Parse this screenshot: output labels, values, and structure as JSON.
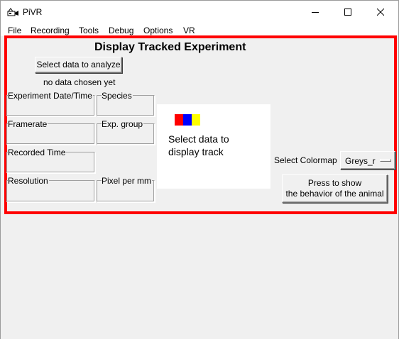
{
  "window": {
    "title": "PiVR",
    "minimize_glyph": "—",
    "maximize_glyph": "☐",
    "close_glyph": "✕"
  },
  "menu": {
    "items": [
      "File",
      "Recording",
      "Tools",
      "Debug",
      "Options",
      "VR"
    ]
  },
  "panel": {
    "heading": "Display Tracked Experiment",
    "select_button": "Select data to analyze",
    "status": "no data chosen yet",
    "fields": {
      "experiment_date": "Experiment Date/Time",
      "species": "Species",
      "framerate": "Framerate",
      "exp_group": "Exp. group",
      "recorded_time": "Recorded Time",
      "resolution": "Resolution",
      "pixel_per_mm": "Pixel per mm"
    },
    "preview": {
      "text": "Select data to\ndisplay track",
      "swatch_colors": [
        "#ff0000",
        "#0000ff",
        "#ffff00"
      ]
    },
    "colormap": {
      "label": "Select Colormap",
      "value": "Greys_r"
    },
    "behavior_button": {
      "line1": "Press to show",
      "line2": "the behavior of the animal"
    }
  },
  "colors": {
    "highlight": "#ff0000",
    "background": "#f0f0f0"
  }
}
